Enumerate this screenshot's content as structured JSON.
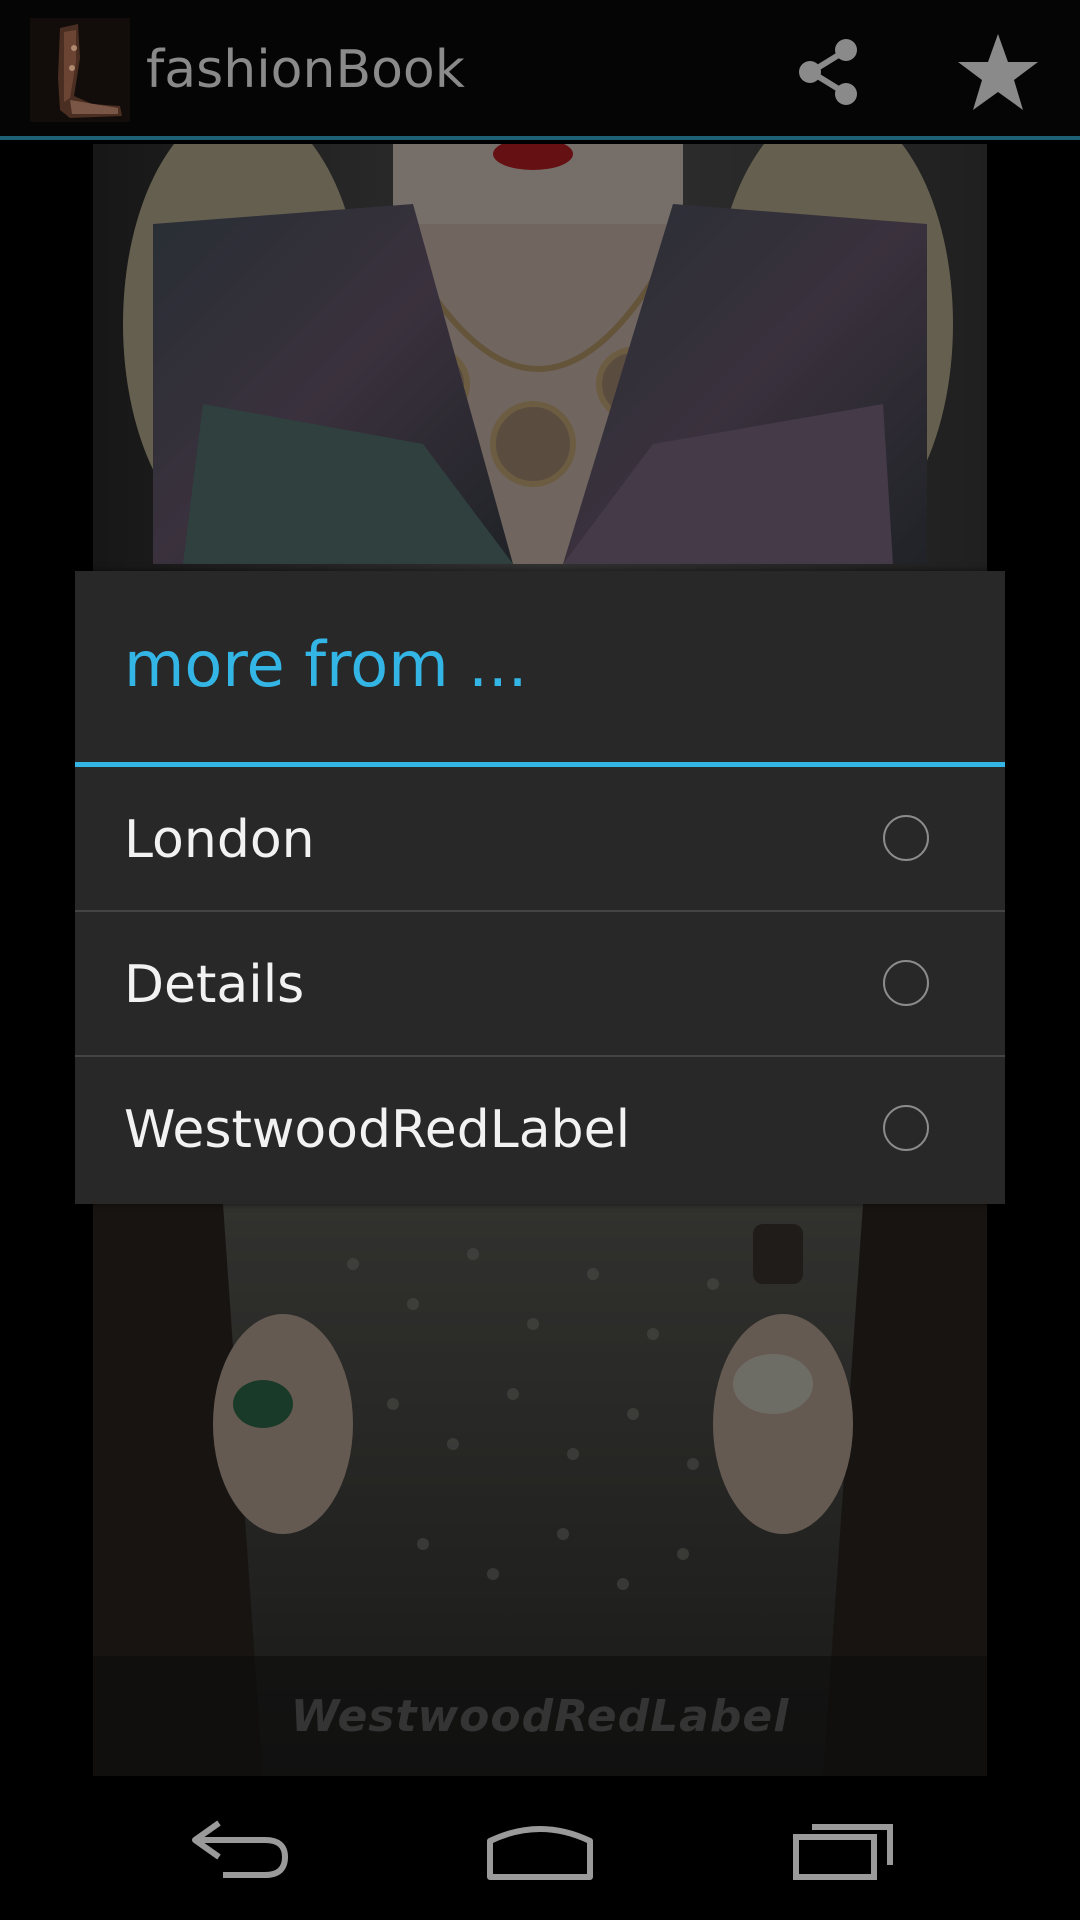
{
  "action_bar": {
    "title": "fashionBook",
    "icons": {
      "app": "boot-thumbnail-icon",
      "share": "share-icon",
      "favorite": "star-icon"
    },
    "accent_color": "#1d5f73"
  },
  "photo": {
    "caption": "WestwoodRedLabel"
  },
  "dialog": {
    "title": "more from ...",
    "accent_color": "#33b5e5",
    "options": [
      {
        "label": "London",
        "selected": false
      },
      {
        "label": "Details",
        "selected": false
      },
      {
        "label": "WestwoodRedLabel",
        "selected": false
      }
    ]
  },
  "nav_bar": {
    "icons": [
      "back-icon",
      "home-icon",
      "recent-apps-icon"
    ]
  }
}
